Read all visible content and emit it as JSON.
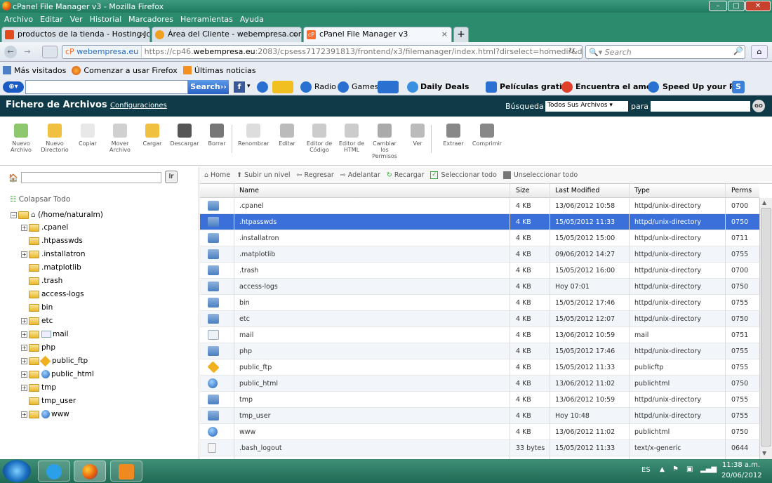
{
  "window": {
    "title": "cPanel File Manager v3 - Mozilla Firefox",
    "min": "–",
    "max": "□",
    "close": "✕"
  },
  "menu": [
    "Archivo",
    "Editar",
    "Ver",
    "Historial",
    "Marcadores",
    "Herramientas",
    "Ayuda"
  ],
  "tabs": [
    {
      "label": "productos de la tienda - Hosting Joo...",
      "close": "×"
    },
    {
      "label": "Área del Cliente - webempresa.com",
      "close": "×"
    },
    {
      "label": "cPanel File Manager v3",
      "close": "×"
    }
  ],
  "new_tab": "+",
  "nav": {
    "site_badge": "webempresa.eu",
    "url_prefix": "https://cp46.",
    "url_domain": "webempresa.eu",
    "url_rest": ":2083/cpsess7172391813/frontend/x3/filemanager/index.html?dirselect=homedir&don",
    "search_placeholder": "Search"
  },
  "bookmarks": [
    "Más visitados",
    "Comenzar a usar Firefox",
    "Últimas noticias"
  ],
  "toolbar2": {
    "search_btn": "Search››",
    "radio": "Radio",
    "games": "Games",
    "daily": "Daily Deals",
    "peliculas": "Películas gratis",
    "amor": "Encuentra el amor",
    "speed": "Speed Up your PC!"
  },
  "cpanel": {
    "title": "Fichero de Archivos",
    "config": "Configuraciones",
    "search_label": "Búsqueda",
    "search_scope": "Todos Sus Archivos",
    "para": "para",
    "go": "GO"
  },
  "tools": [
    {
      "l1": "Nuevo",
      "l2": "Archivo"
    },
    {
      "l1": "Nuevo",
      "l2": "Directorio"
    },
    {
      "l1": "Copiar",
      "l2": ""
    },
    {
      "l1": "Mover",
      "l2": "Archivo"
    },
    {
      "l1": "Cargar",
      "l2": ""
    },
    {
      "l1": "Descargar",
      "l2": ""
    },
    {
      "l1": "Borrar",
      "l2": ""
    },
    {
      "l1": "Renombrar",
      "l2": ""
    },
    {
      "l1": "Editar",
      "l2": ""
    },
    {
      "l1": "Editor de",
      "l2": "Código"
    },
    {
      "l1": "Editor de",
      "l2": "HTML"
    },
    {
      "l1": "Cambiar",
      "l2": "los Permisos"
    },
    {
      "l1": "Ver",
      "l2": ""
    },
    {
      "l1": "Extraer",
      "l2": ""
    },
    {
      "l1": "Comprimir",
      "l2": ""
    }
  ],
  "left": {
    "go_btn": "Ir",
    "collapse": "Colapsar Todo",
    "root": "(/home/naturalm)",
    "tree": [
      ".cpanel",
      ".htpasswds",
      ".installatron",
      ".matplotlib",
      ".trash",
      "access-logs",
      "bin",
      "etc",
      "mail",
      "php",
      "public_ftp",
      "public_html",
      "tmp",
      "tmp_user",
      "www"
    ]
  },
  "actions": {
    "home": "Home",
    "up": "Subir un nivel",
    "back": "Regresar",
    "fwd": "Adelantar",
    "reload": "Recargar",
    "selall": "Seleccionar todo",
    "unsel": "Unseleccionar todo"
  },
  "columns": {
    "name": "Name",
    "size": "Size",
    "modified": "Last Modified",
    "type": "Type",
    "perms": "Perms"
  },
  "files": [
    {
      "name": ".cpanel",
      "size": "4 KB",
      "mod": "13/06/2012 10:58",
      "type": "httpd/unix-directory",
      "perms": "0700",
      "icon": "folder-icon"
    },
    {
      "name": ".htpasswds",
      "size": "4 KB",
      "mod": "15/05/2012 11:33",
      "type": "httpd/unix-directory",
      "perms": "0750",
      "icon": "folder-icon"
    },
    {
      "name": ".installatron",
      "size": "4 KB",
      "mod": "15/05/2012 15:00",
      "type": "httpd/unix-directory",
      "perms": "0711",
      "icon": "folder-icon"
    },
    {
      "name": ".matplotlib",
      "size": "4 KB",
      "mod": "09/06/2012 14:27",
      "type": "httpd/unix-directory",
      "perms": "0755",
      "icon": "folder-icon"
    },
    {
      "name": ".trash",
      "size": "4 KB",
      "mod": "15/05/2012 16:00",
      "type": "httpd/unix-directory",
      "perms": "0700",
      "icon": "folder-icon"
    },
    {
      "name": "access-logs",
      "size": "4 KB",
      "mod": "Hoy 07:01",
      "type": "httpd/unix-directory",
      "perms": "0750",
      "icon": "folder-icon"
    },
    {
      "name": "bin",
      "size": "4 KB",
      "mod": "15/05/2012 17:46",
      "type": "httpd/unix-directory",
      "perms": "0755",
      "icon": "folder-icon"
    },
    {
      "name": "etc",
      "size": "4 KB",
      "mod": "15/05/2012 12:07",
      "type": "httpd/unix-directory",
      "perms": "0750",
      "icon": "folder-icon"
    },
    {
      "name": "mail",
      "size": "4 KB",
      "mod": "13/06/2012 10:59",
      "type": "mail",
      "perms": "0751",
      "icon": "mail-icon"
    },
    {
      "name": "php",
      "size": "4 KB",
      "mod": "15/05/2012 17:46",
      "type": "httpd/unix-directory",
      "perms": "0755",
      "icon": "folder-icon"
    },
    {
      "name": "public_ftp",
      "size": "4 KB",
      "mod": "15/05/2012 11:33",
      "type": "publicftp",
      "perms": "0755",
      "icon": "ftp-icon"
    },
    {
      "name": "public_html",
      "size": "4 KB",
      "mod": "13/06/2012 11:02",
      "type": "publichtml",
      "perms": "0750",
      "icon": "globe-icon"
    },
    {
      "name": "tmp",
      "size": "4 KB",
      "mod": "13/06/2012 10:59",
      "type": "httpd/unix-directory",
      "perms": "0755",
      "icon": "folder-icon"
    },
    {
      "name": "tmp_user",
      "size": "4 KB",
      "mod": "Hoy 10:48",
      "type": "httpd/unix-directory",
      "perms": "0755",
      "icon": "folder-icon"
    },
    {
      "name": "www",
      "size": "4 KB",
      "mod": "13/06/2012 11:02",
      "type": "publichtml",
      "perms": "0750",
      "icon": "globe-icon"
    },
    {
      "name": ".bash_logout",
      "size": "33 bytes",
      "mod": "15/05/2012 11:33",
      "type": "text/x-generic",
      "perms": "0644",
      "icon": "text-file-icon"
    }
  ],
  "selected_row": ".htpasswds",
  "taskbar": {
    "lang": "ES",
    "time": "11:38 a.m.",
    "date": "20/06/2012"
  },
  "colors": {
    "header": "#0e3b47",
    "selected": "#3b6fd9",
    "taskbar": "#2c8a6d"
  }
}
